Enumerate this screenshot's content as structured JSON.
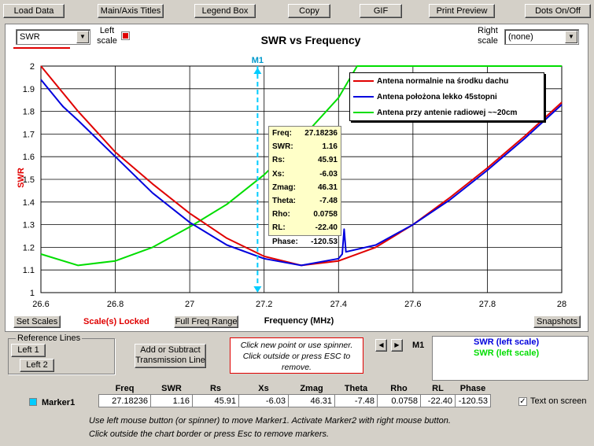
{
  "toolbar": {
    "load_data": "Load Data",
    "main_axis_titles": "Main/Axis Titles",
    "legend_box": "Legend Box",
    "copy": "Copy",
    "gif": "GIF",
    "print_preview": "Print Preview",
    "dots_on_off": "Dots On/Off"
  },
  "left_combo": {
    "value": "SWR",
    "label": "Left scale"
  },
  "right_combo": {
    "value": "(none)",
    "label": "Right scale"
  },
  "colors": {
    "red": "#e00000",
    "blue": "#0000dd",
    "green": "#00dd00",
    "marker": "#00ccff"
  },
  "chart_data": {
    "type": "line",
    "title": "SWR  vs  Frequency",
    "xlabel": "Frequency (MHz)",
    "ylabel": "SWR",
    "xlim": [
      26.6,
      28.0
    ],
    "ylim": [
      1.0,
      2.0
    ],
    "xticks": [
      "26.6",
      "26.8",
      "27",
      "27.2",
      "27.4",
      "27.6",
      "27.8",
      "28"
    ],
    "yticks": [
      "1",
      "1.1",
      "1.2",
      "1.3",
      "1.4",
      "1.5",
      "1.6",
      "1.7",
      "1.8",
      "1.9",
      "2"
    ],
    "grid": true,
    "legend_position": "top-right",
    "series": [
      {
        "name": "Antena normalnie na środku dachu",
        "color": "#e00000",
        "x": [
          26.6,
          26.7,
          26.8,
          26.9,
          27.0,
          27.1,
          27.2,
          27.3,
          27.4,
          27.5,
          27.6,
          27.7,
          27.8,
          27.9,
          28.0
        ],
        "y": [
          2.0,
          1.8,
          1.62,
          1.48,
          1.35,
          1.24,
          1.16,
          1.12,
          1.14,
          1.2,
          1.3,
          1.42,
          1.55,
          1.69,
          1.84
        ]
      },
      {
        "name": "Antena położona lekko 45stopni",
        "color": "#0000dd",
        "x": [
          26.6,
          26.65,
          26.66,
          26.7,
          26.8,
          26.9,
          27.0,
          27.1,
          27.2,
          27.3,
          27.4,
          27.41,
          27.415,
          27.42,
          27.5,
          27.6,
          27.7,
          27.8,
          27.9,
          28.0
        ],
        "y": [
          1.94,
          1.84,
          1.82,
          1.76,
          1.6,
          1.44,
          1.31,
          1.21,
          1.15,
          1.12,
          1.15,
          1.17,
          1.28,
          1.18,
          1.21,
          1.3,
          1.41,
          1.54,
          1.68,
          1.83
        ]
      },
      {
        "name": "Antena przy antenie radiowej ~~20cm",
        "color": "#00dd00",
        "x": [
          26.6,
          26.7,
          26.8,
          26.9,
          27.0,
          27.1,
          27.2,
          27.3,
          27.4,
          27.45,
          28.0
        ],
        "y": [
          1.17,
          1.12,
          1.14,
          1.2,
          1.29,
          1.39,
          1.52,
          1.68,
          1.86,
          2.0,
          2.0
        ]
      }
    ],
    "marker": {
      "label": "M1",
      "x": 27.18236
    }
  },
  "marker_readout": [
    {
      "k": "Freq:",
      "v": "27.18236"
    },
    {
      "k": "SWR:",
      "v": "1.16"
    },
    {
      "k": "Rs:",
      "v": "45.91"
    },
    {
      "k": "Xs:",
      "v": "-6.03"
    },
    {
      "k": "Zmag:",
      "v": "46.31"
    },
    {
      "k": "Theta:",
      "v": "-7.48"
    },
    {
      "k": "Rho:",
      "v": "0.0758"
    },
    {
      "k": "RL:",
      "v": "-22.40"
    },
    {
      "k": "Phase:",
      "v": "-120.53"
    }
  ],
  "chart_buttons": {
    "set_scales": "Set Scales",
    "scales_locked": "Scale(s) Locked",
    "full_freq_range": "Full Freq Range",
    "snapshots": "Snapshots"
  },
  "reference_lines": {
    "title": "Reference Lines",
    "left1": "Left 1",
    "left2": "Left 2"
  },
  "transmission_button": "Add or Subtract Transmission Line",
  "hint_box": "Click new point or use spinner.  Click outside or press ESC to remove.",
  "marker_label": "M1",
  "marker_info": [
    {
      "text": "SWR  (left scale)",
      "color": "#0000dd"
    },
    {
      "text": "SWR  (left scale)",
      "color": "#00dd00"
    }
  ],
  "table": {
    "headers": [
      "Freq",
      "SWR",
      "Rs",
      "Xs",
      "Zmag",
      "Theta",
      "Rho",
      "RL",
      "Phase"
    ],
    "row_label": "Marker1",
    "values": [
      "27.18236",
      "1.16",
      "45.91",
      "-6.03",
      "46.31",
      "-7.48",
      "0.0758",
      "-22.40",
      "-120.53"
    ]
  },
  "text_on_screen": "Text on screen",
  "instructions": [
    "Use left mouse button (or spinner) to move Marker1.  Activate Marker2 with right mouse button.",
    "Click outside the chart border or press Esc to remove markers."
  ]
}
